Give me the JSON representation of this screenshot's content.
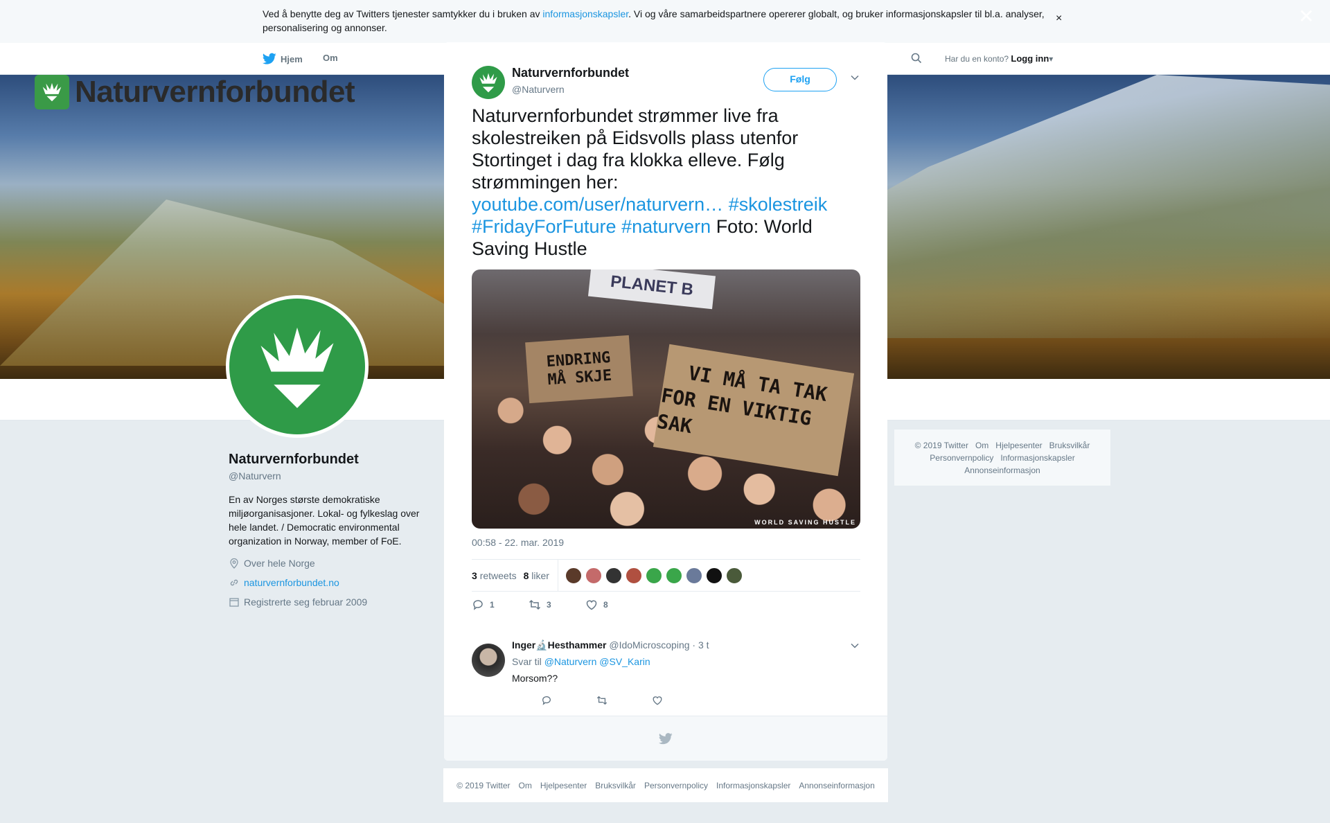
{
  "cookie_bar": {
    "text_before": "Ved å benytte deg av Twitters tjenester samtykker du i bruken av ",
    "link": "informasjonskapsler",
    "text_after": ". Vi og våre samarbeidspartnere opererer globalt, og bruker informasjonskapsler til bl.a. analyser, personalisering og annonser.",
    "close": "×"
  },
  "nav": {
    "home": "Hjem",
    "about": "Om",
    "account_prompt": "Har du en konto?",
    "login": "Logg inn"
  },
  "banner": {
    "logo_text": "Naturvernforbundet"
  },
  "profile": {
    "name": "Naturvernforbundet",
    "handle": "@Naturvern",
    "bio": "En av Norges største demokratiske miljøorganisasjoner. Lokal- og fylkeslag over hele landet. / Democratic environmental organization in Norway, member of FoE.",
    "location": "Over hele Norge",
    "website": "naturvernforbundet.no",
    "joined": "Registrerte seg februar 2009"
  },
  "side_footer": {
    "links": [
      "© 2019 Twitter",
      "Om",
      "Hjelpesenter",
      "Bruksvilkår",
      "Personvernpolicy",
      "Informasjonskapsler",
      "Annonseinformasjon"
    ]
  },
  "overlay": {
    "close": "✕"
  },
  "tweet": {
    "author_name": "Naturvernforbundet",
    "author_handle": "@Naturvern",
    "follow_label": "Følg",
    "text_1": "Naturvernforbundet strømmer live fra skolestreiken på Eidsvolls plass utenfor Stortinget i dag fra klokka elleve. Følg strømmingen her: ",
    "link_1": "youtube.com/user/naturvern…",
    "hashtag_1": "#skolestreik",
    "hashtag_2": "#FridayForFuture",
    "hashtag_3": "#naturvern",
    "text_2": " Foto: World Saving Hustle",
    "photo": {
      "banner_text": "PLANET B",
      "sign_1_line_1": "ENDRING",
      "sign_1_line_2": "MÅ SKJE",
      "sign_2_line_1": "VI MÅ TA TAK",
      "sign_2_line_2": "FOR EN VIKTIG SAK",
      "watermark": "WORLD SAVING HUSTLE"
    },
    "timestamp": "00:58 - 22. mar. 2019",
    "retweets_count": "3",
    "retweets_label": "retweets",
    "likes_count": "8",
    "likes_label": "liker",
    "liker_colors": [
      "#5a3a2a",
      "#c46a6a",
      "#333333",
      "#b05040",
      "#3aa64a",
      "#3aa64a",
      "#6a7a9a",
      "#111111",
      "#4a5a3a"
    ],
    "reply_count": "1",
    "retweet_count": "3",
    "like_count": "8"
  },
  "reply": {
    "name": "Inger🔬Hesthammer",
    "handle": "@IdoMicroscoping",
    "time": "· 3 t",
    "reply_to_label": "Svar til",
    "mention_1": "@Naturvern",
    "mention_2": "@SV_Karin",
    "text": "Morsom??"
  },
  "bottom_footer": {
    "links": [
      "© 2019 Twitter",
      "Om",
      "Hjelpesenter",
      "Bruksvilkår",
      "Personvernpolicy",
      "Informasjonskapsler",
      "Annonseinformasjon"
    ]
  },
  "colors": {
    "accent": "#1da1f2",
    "link": "#1b95e0",
    "brand_green": "#2f9b48"
  }
}
